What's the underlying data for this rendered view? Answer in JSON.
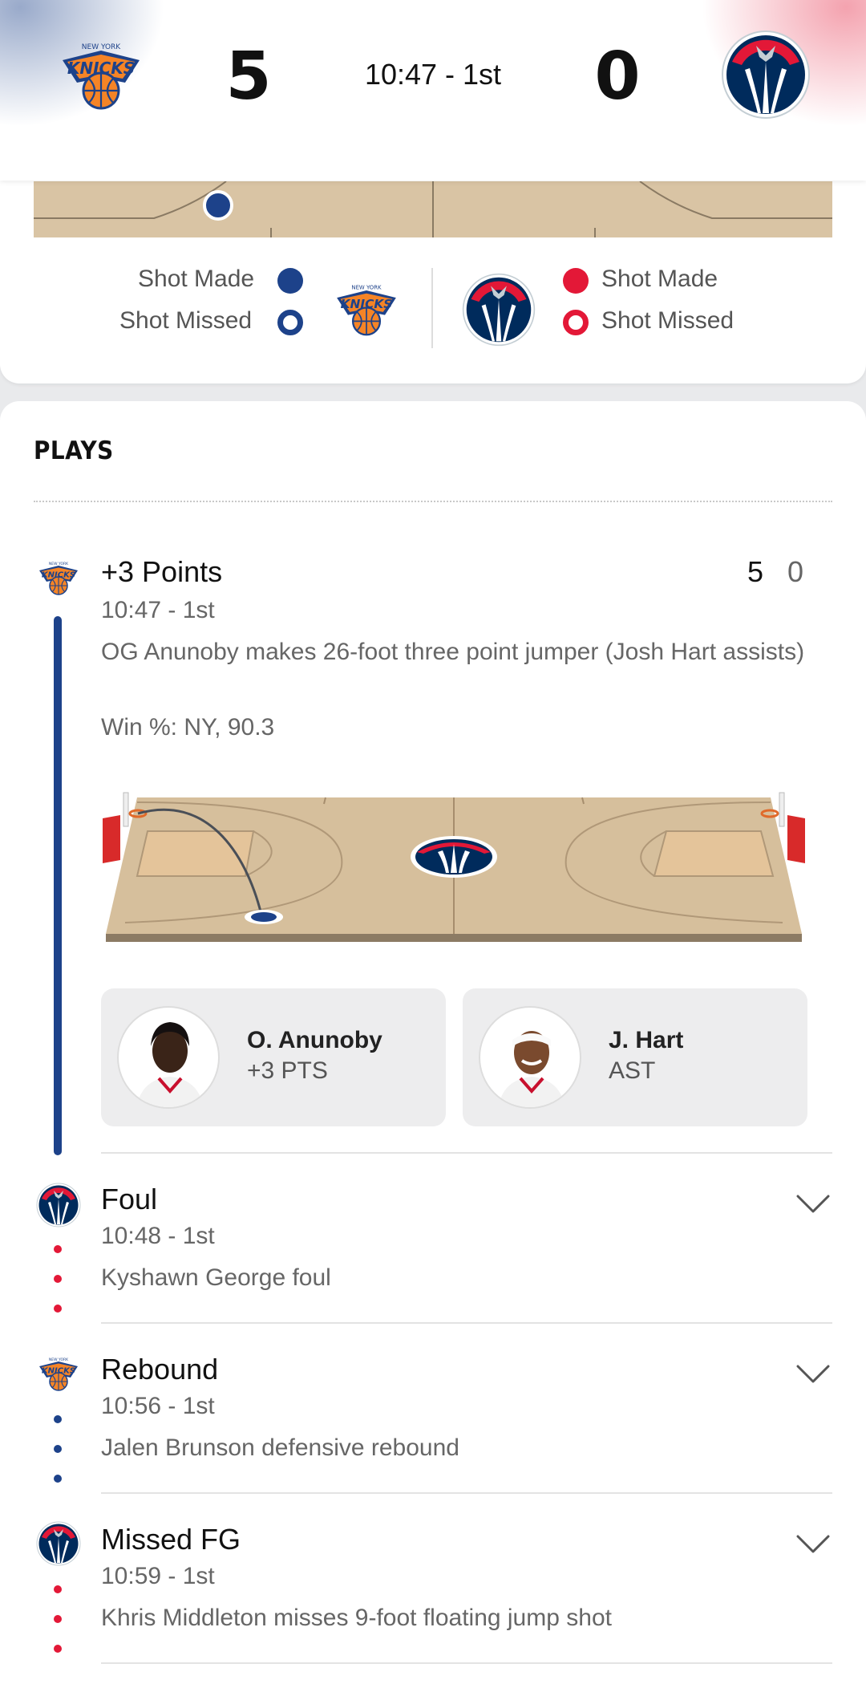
{
  "header": {
    "home_team_logo": "knicks-logo",
    "home_score": "5",
    "clock": "10:47 - 1st",
    "away_score": "0",
    "away_team_logo": "wizards-logo"
  },
  "legend": {
    "home_made": "Shot Made",
    "home_missed": "Shot Missed",
    "away_made": "Shot Made",
    "away_missed": "Shot Missed"
  },
  "colors": {
    "knicks_blue": "#1d428a",
    "knicks_orange": "#f58426",
    "wizards_red": "#e31837",
    "wizards_navy": "#002b5c"
  },
  "plays": {
    "title": "PLAYS",
    "featured": {
      "title": "+3 Points",
      "time": "10:47 - 1st",
      "description": "OG Anunoby makes 26-foot three point jumper (Josh Hart assists)",
      "win_pct": "Win %: NY, 90.3",
      "home_score": "5",
      "away_score": "0",
      "players": [
        {
          "name": "O. Anunoby",
          "stat": "+3 PTS"
        },
        {
          "name": "J. Hart",
          "stat": "AST"
        }
      ]
    },
    "items": [
      {
        "title": "Foul",
        "time": "10:48 - 1st",
        "description": "Kyshawn George foul",
        "team": "wizards"
      },
      {
        "title": "Rebound",
        "time": "10:56 - 1st",
        "description": "Jalen Brunson defensive rebound",
        "team": "knicks"
      },
      {
        "title": "Missed FG",
        "time": "10:59 - 1st",
        "description": "Khris Middleton misses 9-foot floating jump shot",
        "team": "wizards"
      }
    ]
  }
}
